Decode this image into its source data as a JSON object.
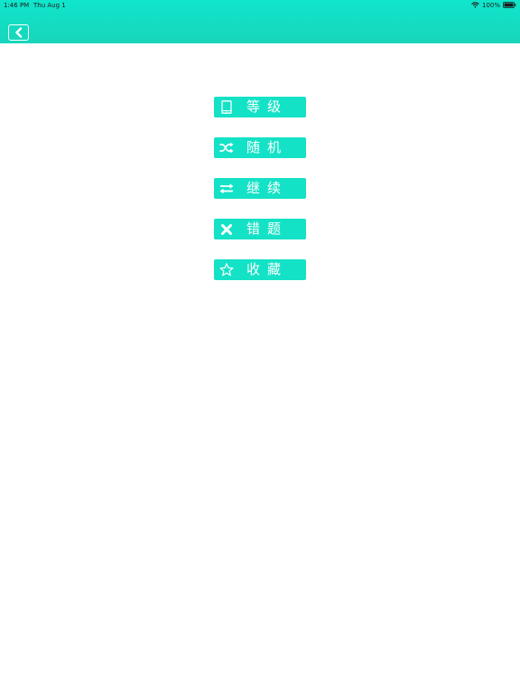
{
  "status_bar": {
    "time": "1:46 PM",
    "date": "Thu Aug 1",
    "battery": "100%"
  },
  "header": {
    "back_icon": "chevron-left-icon",
    "accent_color": "#14e2c6"
  },
  "menu": {
    "items": [
      {
        "label": "等级",
        "icon": "tablet-icon"
      },
      {
        "label": "随机",
        "icon": "shuffle-icon"
      },
      {
        "label": "继续",
        "icon": "repeat-icon"
      },
      {
        "label": "错题",
        "icon": "close-icon"
      },
      {
        "label": "收藏",
        "icon": "star-icon"
      }
    ]
  }
}
